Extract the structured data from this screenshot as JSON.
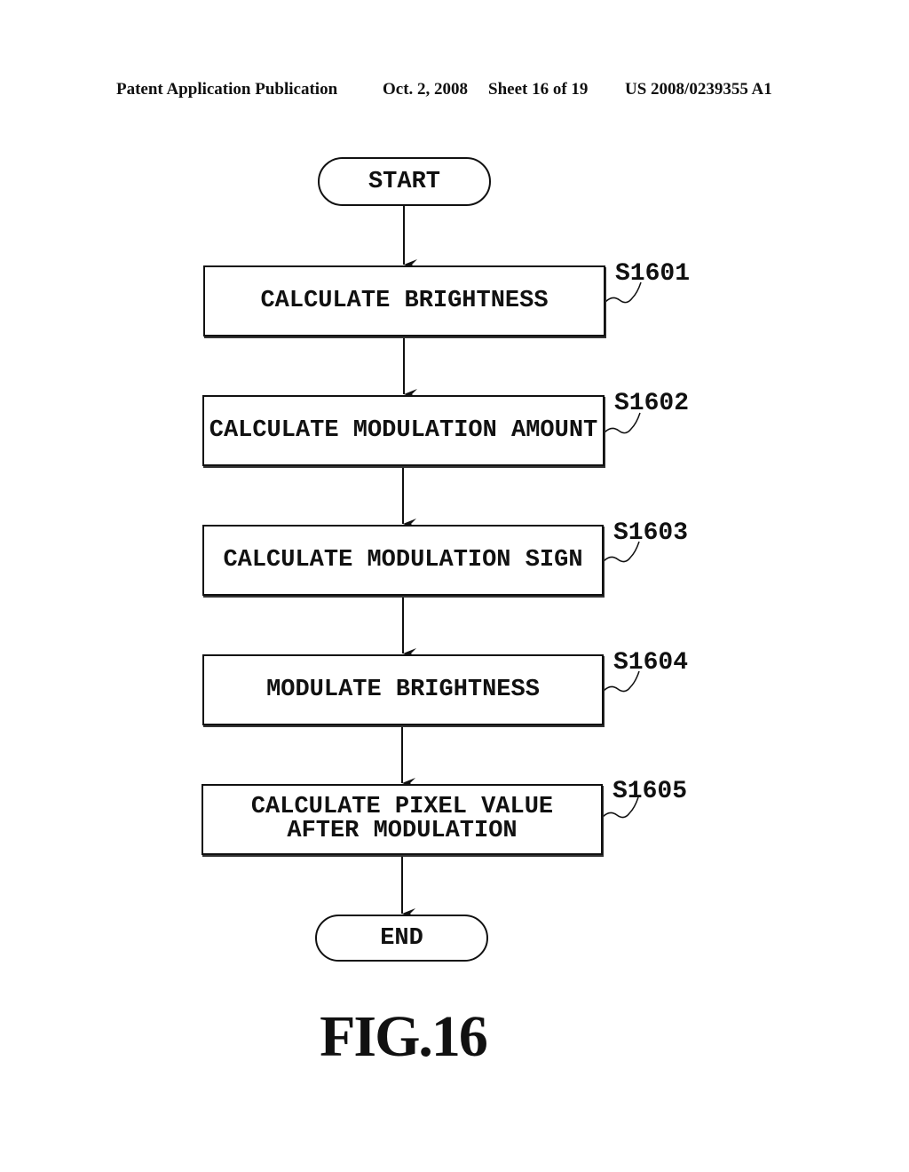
{
  "header": {
    "publication": "Patent Application Publication",
    "date": "Oct. 2, 2008",
    "sheet": "Sheet 16 of 19",
    "number": "US 2008/0239355 A1"
  },
  "flowchart": {
    "start": "START",
    "end": "END",
    "steps": [
      {
        "id": "S1601",
        "text": "CALCULATE BRIGHTNESS"
      },
      {
        "id": "S1602",
        "text": "CALCULATE MODULATION AMOUNT"
      },
      {
        "id": "S1603",
        "text": "CALCULATE MODULATION SIGN"
      },
      {
        "id": "S1604",
        "text": "MODULATE BRIGHTNESS"
      },
      {
        "id": "S1605",
        "text": "CALCULATE PIXEL VALUE AFTER MODULATION"
      }
    ]
  },
  "figure_label": "FIG.16"
}
